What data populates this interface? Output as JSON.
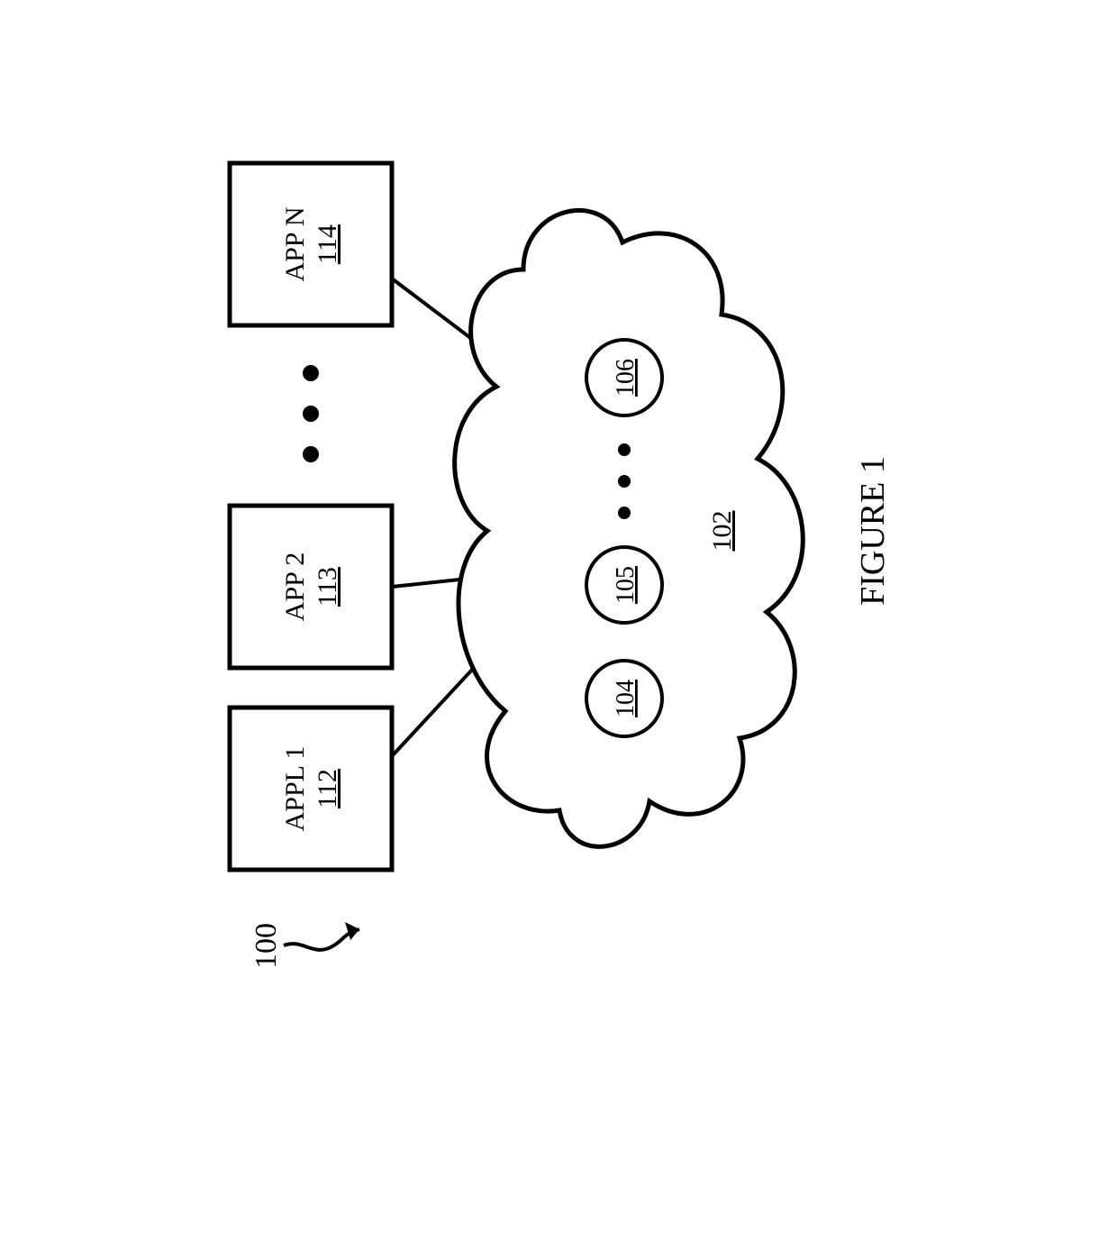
{
  "figure": {
    "ref_label": "100",
    "caption": "FIGURE 1",
    "cloud_ref": "102",
    "apps": [
      {
        "title": "APPL 1",
        "ref": "112"
      },
      {
        "title": "APP 2",
        "ref": "113"
      },
      {
        "title": "APP N",
        "ref": "114"
      }
    ],
    "nodes": [
      {
        "ref": "104"
      },
      {
        "ref": "105"
      },
      {
        "ref": "106"
      }
    ]
  }
}
